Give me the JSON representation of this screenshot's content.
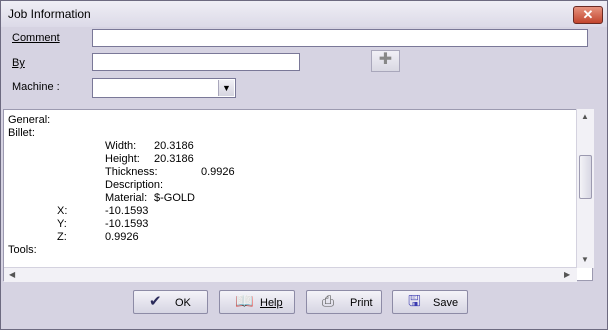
{
  "window": {
    "title": "Job Information",
    "close_glyph": "✕"
  },
  "form": {
    "comment_label": "Comment",
    "comment_value": "",
    "by_label": "By",
    "by_value": "",
    "machine_label": "Machine :",
    "machine_value": ""
  },
  "report": {
    "general": "General:",
    "billet": "Billet:",
    "width_label": "Width:",
    "width_value": "20.3186",
    "height_label": "Height:",
    "height_value": "20.3186",
    "thickness_label": "Thickness:",
    "thickness_value": "0.9926",
    "description_label": "Description:",
    "material_label": "Material:",
    "material_value": "$-GOLD",
    "x_label": "X:",
    "x_value": "-10.1593",
    "y_label": "Y:",
    "y_value": "-10.1593",
    "z_label": "Z:",
    "z_value": "0.9926",
    "tools": "Tools:"
  },
  "buttons": {
    "ok": "OK",
    "help": "Help",
    "print": "Print",
    "save": "Save"
  },
  "icons": {
    "ok": "check-icon",
    "help": "help-book-icon",
    "print": "printer-icon",
    "save": "floppy-disk-icon",
    "add": "plus-icon"
  }
}
